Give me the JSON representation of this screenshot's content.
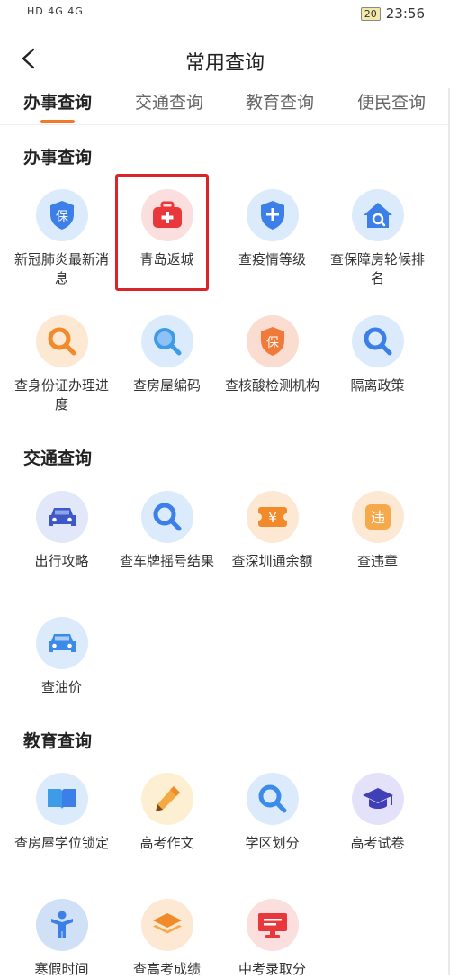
{
  "status_bar": {
    "left_indicators": "HD 4G 4G",
    "battery": "20",
    "time": "23:56"
  },
  "header": {
    "title": "常用查询"
  },
  "tabs": [
    "办事查询",
    "交通查询",
    "教育查询",
    "便民查询"
  ],
  "sections": {
    "affairs": {
      "title": "办事查询",
      "items": [
        {
          "label": "新冠肺炎最新消息",
          "icon": "shield-icon",
          "glyph": "保"
        },
        {
          "label": "青岛返城",
          "icon": "first-aid-kit-icon",
          "glyph": "+"
        },
        {
          "label": "查疫情等级",
          "icon": "shield-plus-icon",
          "glyph": "+"
        },
        {
          "label": "查保障房轮候排名",
          "icon": "house-search-icon",
          "glyph": "⌂"
        },
        {
          "label": "查身份证办理进度",
          "icon": "search-icon",
          "glyph": ""
        },
        {
          "label": "查房屋编码",
          "icon": "search-icon",
          "glyph": ""
        },
        {
          "label": "查核酸检测机构",
          "icon": "shield-icon",
          "glyph": "保"
        },
        {
          "label": "隔离政策",
          "icon": "search-icon",
          "glyph": ""
        }
      ]
    },
    "traffic": {
      "title": "交通查询",
      "items": [
        {
          "label": "出行攻略",
          "icon": "car-icon",
          "glyph": ""
        },
        {
          "label": "查车牌摇号结果",
          "icon": "search-icon",
          "glyph": ""
        },
        {
          "label": "查深圳通余额",
          "icon": "yuan-ticket-icon",
          "glyph": "¥"
        },
        {
          "label": "查违章",
          "icon": "violation-icon",
          "glyph": "违"
        },
        {
          "label": "查油价",
          "icon": "car-icon",
          "glyph": ""
        }
      ]
    },
    "education": {
      "title": "教育查询",
      "items": [
        {
          "label": "查房屋学位锁定",
          "icon": "book-icon",
          "glyph": ""
        },
        {
          "label": "高考作文",
          "icon": "pencil-icon",
          "glyph": "✎"
        },
        {
          "label": "学区划分",
          "icon": "search-icon",
          "glyph": ""
        },
        {
          "label": "高考试卷",
          "icon": "graduation-cap-icon",
          "glyph": ""
        },
        {
          "label": "寒假时间",
          "icon": "person-icon",
          "glyph": ""
        },
        {
          "label": "查高考成绩",
          "icon": "layers-icon",
          "glyph": ""
        },
        {
          "label": "中考录取分",
          "icon": "monitor-icon",
          "glyph": ""
        }
      ]
    }
  },
  "colors": {
    "accent": "#f07a28",
    "highlight_box": "#d9252a",
    "blue_bg": "#dcebfb",
    "blue_fg": "#3d7fe8",
    "orange_bg": "#fde8d3",
    "orange_fg": "#f08a2a",
    "red_bg": "#fbdede",
    "red_fg": "#e8383b"
  }
}
